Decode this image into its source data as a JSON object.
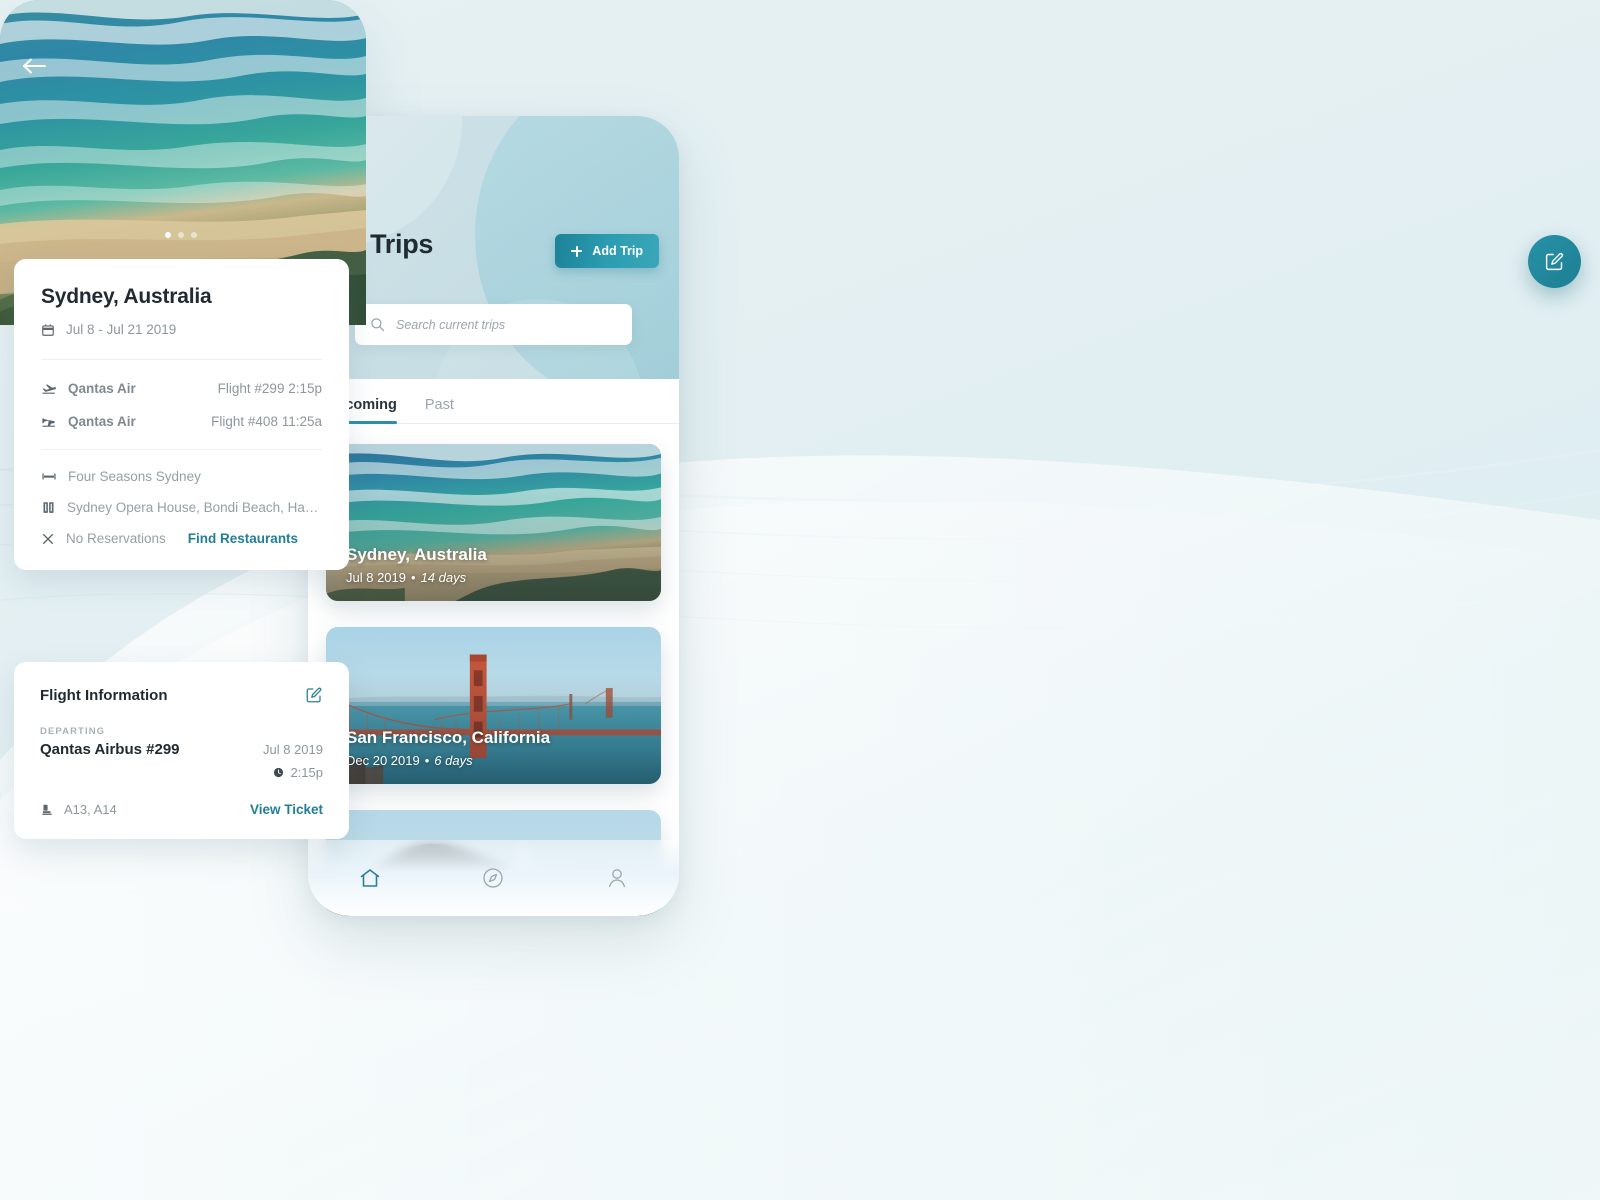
{
  "background": {
    "base_color": "#e3eff2",
    "accent_color": "#2b90a8"
  },
  "trips_screen": {
    "menu_icon": "hamburger-menu-icon",
    "title": "My Trips",
    "add_trip": {
      "label": "Add Trip",
      "icon": "plus-icon"
    },
    "search": {
      "icon": "search-icon",
      "placeholder": "Search current trips",
      "value": ""
    },
    "tabs": [
      {
        "label": "Upcoming",
        "active": true
      },
      {
        "label": "Past",
        "active": false
      }
    ],
    "trips": [
      {
        "name": "Sydney, Australia",
        "date": "Jul 8 2019",
        "separator": "•",
        "duration": "14 days",
        "photo": "ocean-beach-aerial"
      },
      {
        "name": "San Francisco, California",
        "date": "Dec 20 2019",
        "separator": "•",
        "duration": "6 days",
        "photo": "golden-gate-bridge"
      },
      {
        "name": "",
        "date": "",
        "separator": "",
        "duration": "",
        "photo": "volcano-mountain-landscape"
      }
    ],
    "bottom_nav": [
      {
        "icon": "home-icon",
        "active": true
      },
      {
        "icon": "compass-icon",
        "active": false
      },
      {
        "icon": "profile-icon",
        "active": false
      }
    ]
  },
  "detail_screen": {
    "hero": {
      "photo": "ocean-beach-aerial",
      "back_icon": "back-arrow-icon",
      "carousel_dots": 3,
      "active_dot": 0
    },
    "edit_fab_icon": "edit-square-icon",
    "summary": {
      "title": "Sydney, Australia",
      "date_icon": "calendar-icon",
      "date_range": "Jul 8 - Jul 21 2019",
      "flights": [
        {
          "icon": "flight-takeoff-icon",
          "airline": "Qantas Air",
          "detail": "Flight #299 2:15p"
        },
        {
          "icon": "flight-land-icon",
          "airline": "Qantas Air",
          "detail": "Flight #408 11:25a"
        }
      ],
      "details": [
        {
          "icon": "bed-icon",
          "text": "Four Seasons Sydney",
          "link": ""
        },
        {
          "icon": "book-icon",
          "text": "Sydney Opera House, Bondi Beach, Harbo…",
          "link": ""
        },
        {
          "icon": "close-x-icon",
          "text": "No Reservations",
          "link": "Find Restaurants"
        }
      ]
    },
    "flight_card": {
      "title": "Flight Information",
      "edit_icon": "edit-square-icon",
      "section_label": "DEPARTING",
      "plane": "Qantas Airbus #299",
      "date": "Jul 8 2019",
      "time_icon": "clock-icon",
      "time": "2:15p",
      "seat_icon": "seat-icon",
      "seats": "A13, A14",
      "view_ticket": "View Ticket"
    }
  }
}
